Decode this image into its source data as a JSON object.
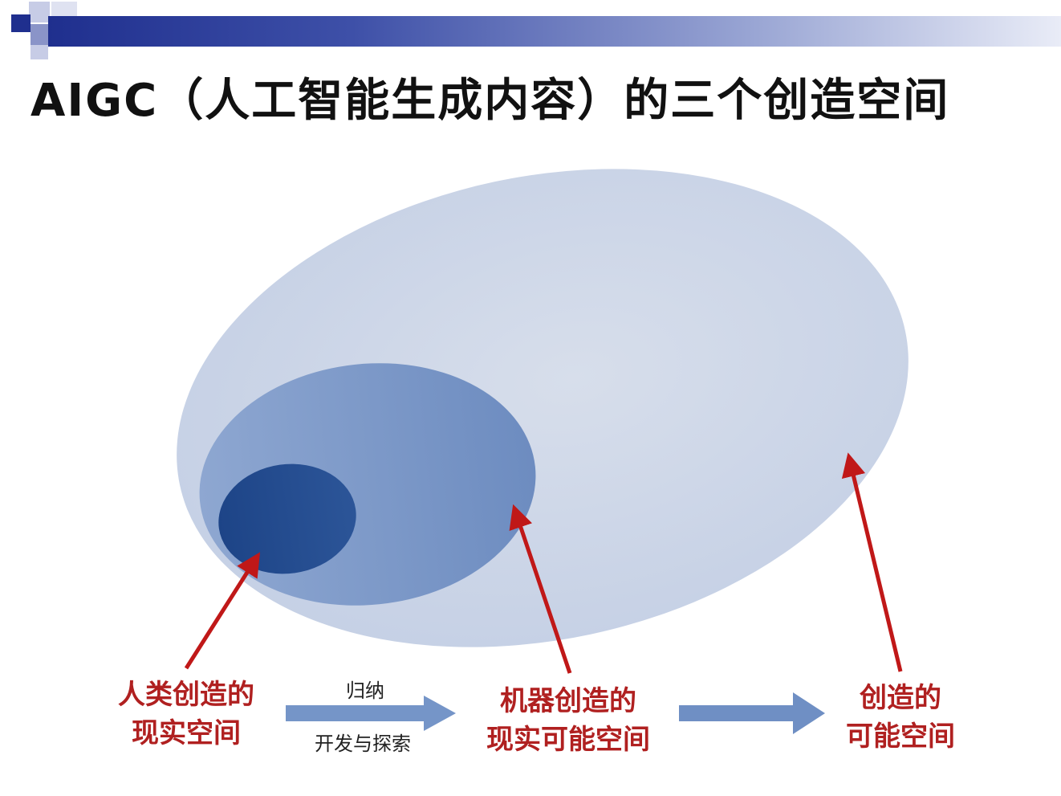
{
  "title": "AIGC（人工智能生成内容）的三个创造空间",
  "spaces": {
    "human": {
      "line1": "人类创造的",
      "line2": "现实空间"
    },
    "machine": {
      "line1": "机器创造的",
      "line2": "现实可能空间"
    },
    "creation": {
      "line1": "创造的",
      "line2": "可能空间"
    }
  },
  "flow": {
    "arrow1_top": "归纳",
    "arrow1_bottom": "开发与探索"
  },
  "colors": {
    "outer_ellipse": "#cfd8e8",
    "middle_ellipse": "#7b97c4",
    "inner_ellipse": "#1f4a8a",
    "pointer_red": "#c01818",
    "flow_arrow": "#6f8fc4"
  }
}
